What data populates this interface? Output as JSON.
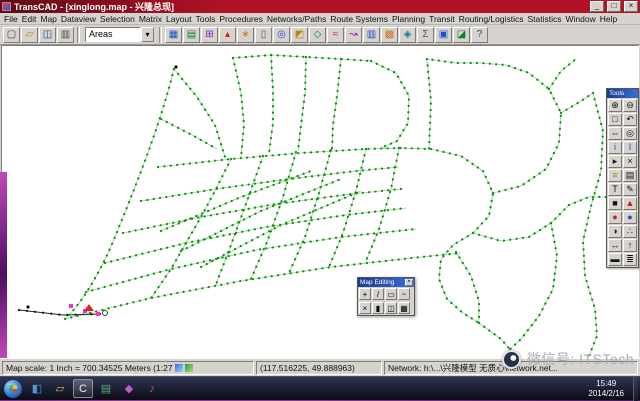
{
  "colors": {
    "titlebar-a": "#b01226",
    "titlebar-b": "#5f0a14",
    "chrome": "#d6d3ce",
    "map-bg": "#ffffff",
    "net-link": "#8fd48f",
    "net-node": "#0d8c0d",
    "wall-a": "#c448b8",
    "wall-b": "#4a1060",
    "task-a": "#2e3450",
    "task-b": "#0a0c16",
    "edit-pink": "#ff2ad4"
  },
  "window": {
    "title": "TransCAD - [xinglong.map - 兴隆总现]",
    "minimize": "_",
    "maximize": "□",
    "close": "×"
  },
  "menu": {
    "items": [
      "File",
      "Edit",
      "Map",
      "Dataview",
      "Selection",
      "Matrix",
      "Layout",
      "Tools",
      "Procedures",
      "Networks/Paths",
      "Route Systems",
      "Planning",
      "Transit",
      "Routing/Logistics",
      "Statistics",
      "Window",
      "Help"
    ]
  },
  "toolbar": {
    "file_buttons": [
      {
        "name": "new-file",
        "glyph": "▢",
        "color": "#444444"
      },
      {
        "name": "open-file",
        "glyph": "▱",
        "color": "#b8860b"
      },
      {
        "name": "save-file",
        "glyph": "◫",
        "color": "#14459c"
      },
      {
        "name": "print",
        "glyph": "▥",
        "color": "#444444"
      }
    ],
    "layer_dropdown": {
      "value": "Areas",
      "arrow": "▾"
    },
    "icons": [
      {
        "name": "map-properties",
        "glyph": "▦",
        "color": "#1a4fd1"
      },
      {
        "name": "dataview",
        "glyph": "▤",
        "color": "#0c7c33"
      },
      {
        "name": "matrix",
        "glyph": "⊞",
        "color": "#8a1ad1"
      },
      {
        "name": "chart",
        "glyph": "▴",
        "color": "#d11a1a"
      },
      {
        "name": "map-wizard",
        "glyph": "∗",
        "color": "#d1771a"
      },
      {
        "name": "layout",
        "glyph": "▯",
        "color": "#555555"
      },
      {
        "name": "locate",
        "glyph": "◎",
        "color": "#1a4fd1"
      },
      {
        "name": "selection",
        "glyph": "◩",
        "color": "#b8860b"
      },
      {
        "name": "network",
        "glyph": "◇",
        "color": "#0c7c33"
      },
      {
        "name": "shortest-path",
        "glyph": "≈",
        "color": "#d11a6e"
      },
      {
        "name": "route-system",
        "glyph": "↝",
        "color": "#8a1ad1"
      },
      {
        "name": "transit",
        "glyph": "▥",
        "color": "#1a4fd1"
      },
      {
        "name": "planning",
        "glyph": "▩",
        "color": "#d1771a"
      },
      {
        "name": "logistics",
        "glyph": "◈",
        "color": "#0c7c8a"
      },
      {
        "name": "statistics",
        "glyph": "Σ",
        "color": "#555555"
      },
      {
        "name": "window-tile",
        "glyph": "▣",
        "color": "#1a4fd1"
      },
      {
        "name": "overlay",
        "glyph": "◪",
        "color": "#0c7c33"
      },
      {
        "name": "help",
        "glyph": "?",
        "color": "#14459c"
      }
    ]
  },
  "tools_palette": {
    "title": "Tools",
    "buttons": [
      {
        "name": "zoom-in",
        "glyph": "⊕",
        "color": "#111111"
      },
      {
        "name": "zoom-out",
        "glyph": "⊖",
        "color": "#111111"
      },
      {
        "name": "zoom-window",
        "glyph": "□",
        "color": "#111111"
      },
      {
        "name": "previous-scale",
        "glyph": "↶",
        "color": "#111111"
      },
      {
        "name": "pan",
        "glyph": "⇔",
        "color": "#111111"
      },
      {
        "name": "recenter",
        "glyph": "◎",
        "color": "#111111"
      },
      {
        "name": "info",
        "glyph": "i",
        "color": "#1a4fd1"
      },
      {
        "name": "multi-info",
        "glyph": "I",
        "color": "#1a4fd1"
      },
      {
        "name": "select-point",
        "glyph": "▸",
        "color": "#111111"
      },
      {
        "name": "clear-selection",
        "glyph": "×",
        "color": "#111111"
      },
      {
        "name": "select-rows",
        "glyph": "≡",
        "color": "#b8860b"
      },
      {
        "name": "layers",
        "glyph": "▤",
        "color": "#111111"
      },
      {
        "name": "label",
        "glyph": "T",
        "color": "#111111"
      },
      {
        "name": "freehand",
        "glyph": "✎",
        "color": "#111111"
      },
      {
        "name": "fill-style",
        "glyph": "■",
        "color": "#111111"
      },
      {
        "name": "theme-triangle",
        "glyph": "▲",
        "color": "#c22222"
      },
      {
        "name": "theme-dot-red",
        "glyph": "●",
        "color": "#c22222"
      },
      {
        "name": "theme-dot-blue",
        "glyph": "●",
        "color": "#1a4fd1"
      },
      {
        "name": "pie-theme",
        "glyph": "◑",
        "color": "#111111"
      },
      {
        "name": "scatter-theme",
        "glyph": "∴",
        "color": "#111111"
      },
      {
        "name": "measure",
        "glyph": "↔",
        "color": "#111111"
      },
      {
        "name": "north-arrow",
        "glyph": "↑",
        "color": "#111111"
      },
      {
        "name": "scale-bar",
        "glyph": "▬",
        "color": "#111111"
      },
      {
        "name": "palette-more",
        "glyph": "≣",
        "color": "#111111"
      }
    ]
  },
  "map_editing": {
    "title": "Map Editing",
    "close": "×",
    "row1": [
      {
        "name": "add-node",
        "glyph": "+"
      },
      {
        "name": "add-link",
        "glyph": "/"
      },
      {
        "name": "move-node",
        "glyph": "▭"
      },
      {
        "name": "reshape-link",
        "glyph": "~"
      }
    ],
    "row2": [
      {
        "name": "delete-element",
        "glyph": "×"
      },
      {
        "name": "merge-links",
        "glyph": "▮"
      },
      {
        "name": "split-link",
        "glyph": "◫"
      },
      {
        "name": "save-edits",
        "glyph": "▦"
      }
    ]
  },
  "status_bar": {
    "scale_text": "Map scale: 1 Inch = 700.34525 Meters (1:27",
    "coords_text": "(117.516225, 49.888963)",
    "network_text": "Network: h:\\...\\兴隆模型 无质心\\network.net..."
  },
  "taskbar": {
    "time": "15:49",
    "date": "2014/2/16",
    "apps": [
      {
        "name": "taskbar-app-1",
        "glyph": "◧",
        "color": "#5a8fd6"
      },
      {
        "name": "taskbar-app-2",
        "glyph": "▱",
        "color": "#e0b84a"
      },
      {
        "name": "taskbar-app-3",
        "glyph": "C",
        "color": "#f0f0f0"
      },
      {
        "name": "taskbar-app-4",
        "glyph": "▤",
        "color": "#58b06a"
      },
      {
        "name": "taskbar-app-5",
        "glyph": "◆",
        "color": "#c45ad1"
      },
      {
        "name": "taskbar-app-6",
        "glyph": "♪",
        "color": "#d65a5a"
      }
    ]
  },
  "watermark": {
    "text": "微信号: ITSTech"
  }
}
